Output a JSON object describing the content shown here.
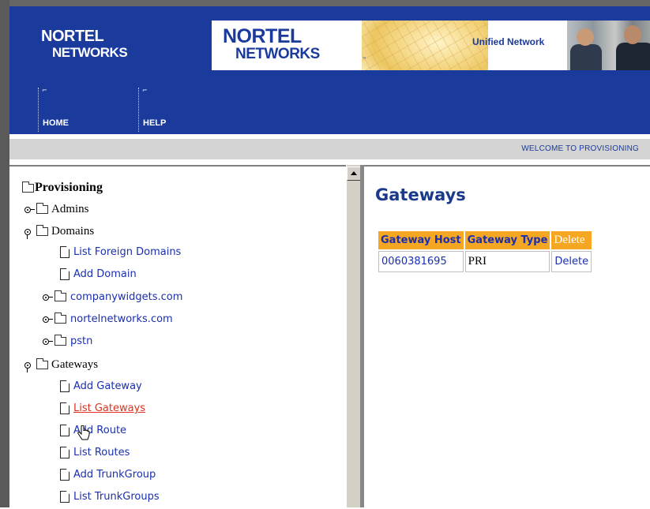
{
  "header": {
    "logo_line1": "NORTEL",
    "logo_line2": "NETWORKS",
    "banner_line1": "NORTEL",
    "banner_line2": "NETWORKS",
    "banner_tm": "™",
    "banner_tagline": "Unified Network"
  },
  "nav": [
    {
      "label": "HOME"
    },
    {
      "label": "HELP"
    }
  ],
  "welcome_text": "WELCOME TO PROVISIONING",
  "tree": {
    "root": "Provisioning",
    "admins": "Admins",
    "domains": "Domains",
    "list_foreign_domains": "List Foreign Domains",
    "add_domain": "Add Domain",
    "domain_items": [
      "companywidgets.com",
      "nortelnetworks.com",
      "pstn"
    ],
    "gateways": "Gateways",
    "gateway_links": [
      "Add Gateway",
      "List Gateways",
      "Add Route",
      "List Routes",
      "Add TrunkGroup",
      "List TrunkGroups"
    ],
    "active_link": "List Gateways"
  },
  "content": {
    "title": "Gateways",
    "table": {
      "headers": [
        "Gateway Host",
        "Gateway Type",
        "Delete"
      ],
      "rows": [
        {
          "host": "0060381695",
          "type": "PRI",
          "action": "Delete"
        }
      ]
    }
  },
  "colors": {
    "header_bg": "#1a3a9c",
    "link": "#1a2fb0",
    "active_link": "#e0301e",
    "table_header_bg": "#f5a623",
    "title": "#1a3a8c"
  }
}
